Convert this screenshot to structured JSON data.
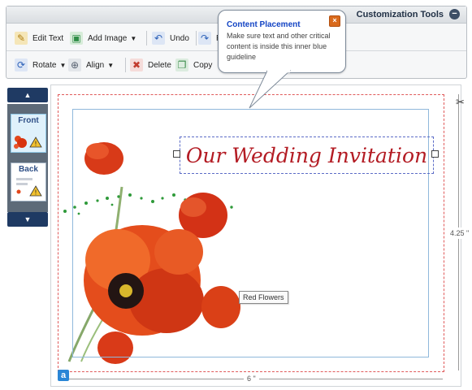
{
  "toolbar": {
    "title": "Customization Tools",
    "collapse_symbol": "−",
    "row1": [
      {
        "id": "edit-text",
        "label": "Edit Text",
        "icon": "pencil-icon",
        "symbol": "✎",
        "color": "#d9a320",
        "caret": false
      },
      {
        "id": "add-image",
        "label": "Add Image",
        "icon": "image-icon",
        "symbol": "▣",
        "color": "#2f8d46",
        "caret": true
      },
      {
        "id": "undo",
        "label": "Undo",
        "icon": "undo-icon",
        "symbol": "↶",
        "color": "#2d61b8",
        "caret": false
      },
      {
        "id": "redo",
        "label": "Re",
        "icon": "redo-icon",
        "symbol": "↷",
        "color": "#2d61b8",
        "caret": false
      }
    ],
    "row2": [
      {
        "id": "rotate",
        "label": "Rotate",
        "icon": "rotate-icon",
        "symbol": "⟳",
        "color": "#2d61b8",
        "caret": true
      },
      {
        "id": "align",
        "label": "Align",
        "icon": "align-icon",
        "symbol": "⊕",
        "color": "#555f6e",
        "caret": true
      },
      {
        "id": "delete",
        "label": "Delete",
        "icon": "delete-icon",
        "symbol": "✖",
        "color": "#c23b2e",
        "caret": false
      },
      {
        "id": "copy",
        "label": "Copy",
        "icon": "copy-icon",
        "symbol": "❐",
        "color": "#3b8c4a",
        "caret": false
      }
    ]
  },
  "popup": {
    "title": "Content Placement",
    "body": "Make sure text and other critical content is inside this inner blue guideline",
    "close_symbol": "×"
  },
  "sidebar": {
    "up_symbol": "▲",
    "down_symbol": "▼",
    "items": [
      {
        "label": "Front",
        "active": true
      },
      {
        "label": "Back",
        "active": false
      }
    ]
  },
  "canvas": {
    "title": "Our Wedding Invitation",
    "tooltip": "Red Flowers",
    "width_label": "6 \"",
    "height_label": "4.25 \""
  },
  "colors": {
    "safe_guide": "#8fb8db",
    "bleed_guide": "#e05a5a",
    "title_text": "#b31b23",
    "popup_title": "#1344c4"
  }
}
